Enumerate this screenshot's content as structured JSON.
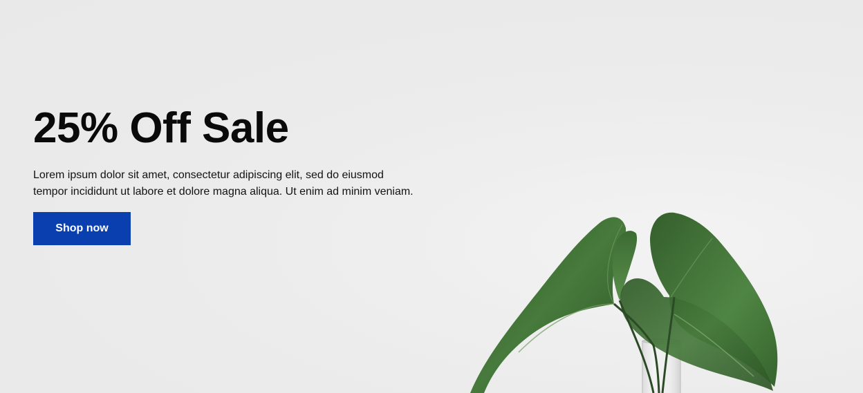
{
  "hero": {
    "title": "25% Off Sale",
    "body": "Lorem ipsum dolor sit amet, consectetur adipiscing elit, sed do eiusmod tempor incididunt ut labore et dolore magna aliqua. Ut enim ad minim veniam.",
    "cta_label": "Shop now"
  },
  "colors": {
    "background": "#ebebeb",
    "cta_background": "#0a3fb0",
    "cta_text": "#ffffff",
    "title": "#0a0a0a",
    "leaf": "#3f6b35"
  },
  "image": {
    "icon": "plant-in-glass-vase"
  }
}
